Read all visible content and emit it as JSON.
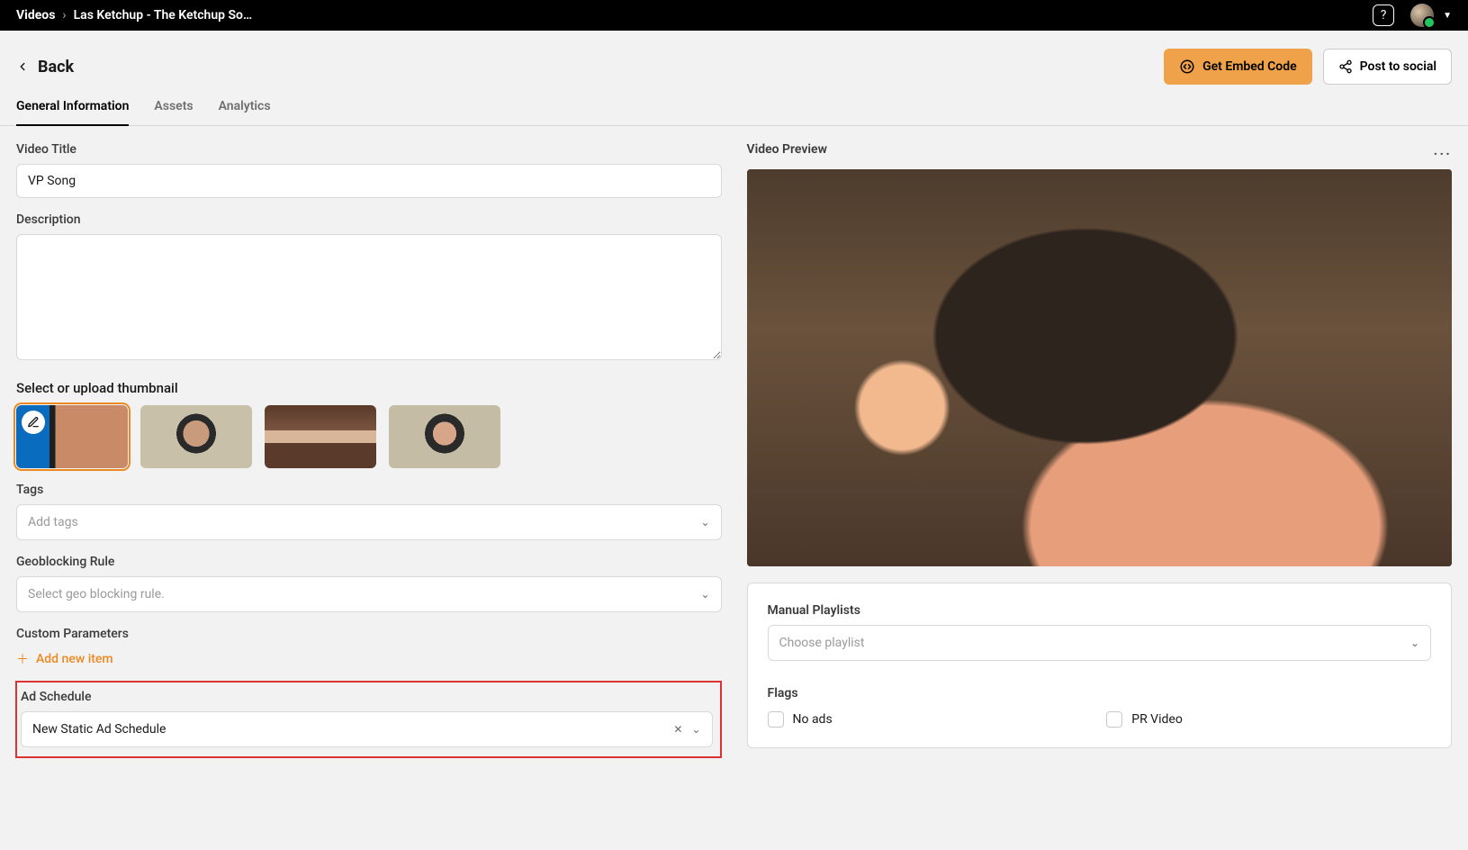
{
  "breadcrumb": {
    "root": "Videos",
    "current": "Las Ketchup - The Ketchup So…"
  },
  "header": {
    "back_label": "Back",
    "embed_label": "Get Embed Code",
    "post_label": "Post to social"
  },
  "tabs": [
    {
      "id": "general",
      "label": "General Information",
      "active": true
    },
    {
      "id": "assets",
      "label": "Assets",
      "active": false
    },
    {
      "id": "analytics",
      "label": "Analytics",
      "active": false
    }
  ],
  "left": {
    "title_label": "Video Title",
    "title_value": "VP Song",
    "description_label": "Description",
    "description_value": "",
    "thumbnail_label": "Select or upload thumbnail",
    "tags_label": "Tags",
    "tags_placeholder": "Add tags",
    "geoblock_label": "Geoblocking Rule",
    "geoblock_placeholder": "Select geo blocking rule.",
    "custom_params_label": "Custom Parameters",
    "add_item_label": "Add new item",
    "ad_schedule_label": "Ad Schedule",
    "ad_schedule_value": "New Static Ad Schedule"
  },
  "right": {
    "preview_label": "Video Preview",
    "playlists_label": "Manual Playlists",
    "playlists_placeholder": "Choose playlist",
    "flags_label": "Flags",
    "flag_noads": "No ads",
    "flag_pr": "PR Video"
  }
}
